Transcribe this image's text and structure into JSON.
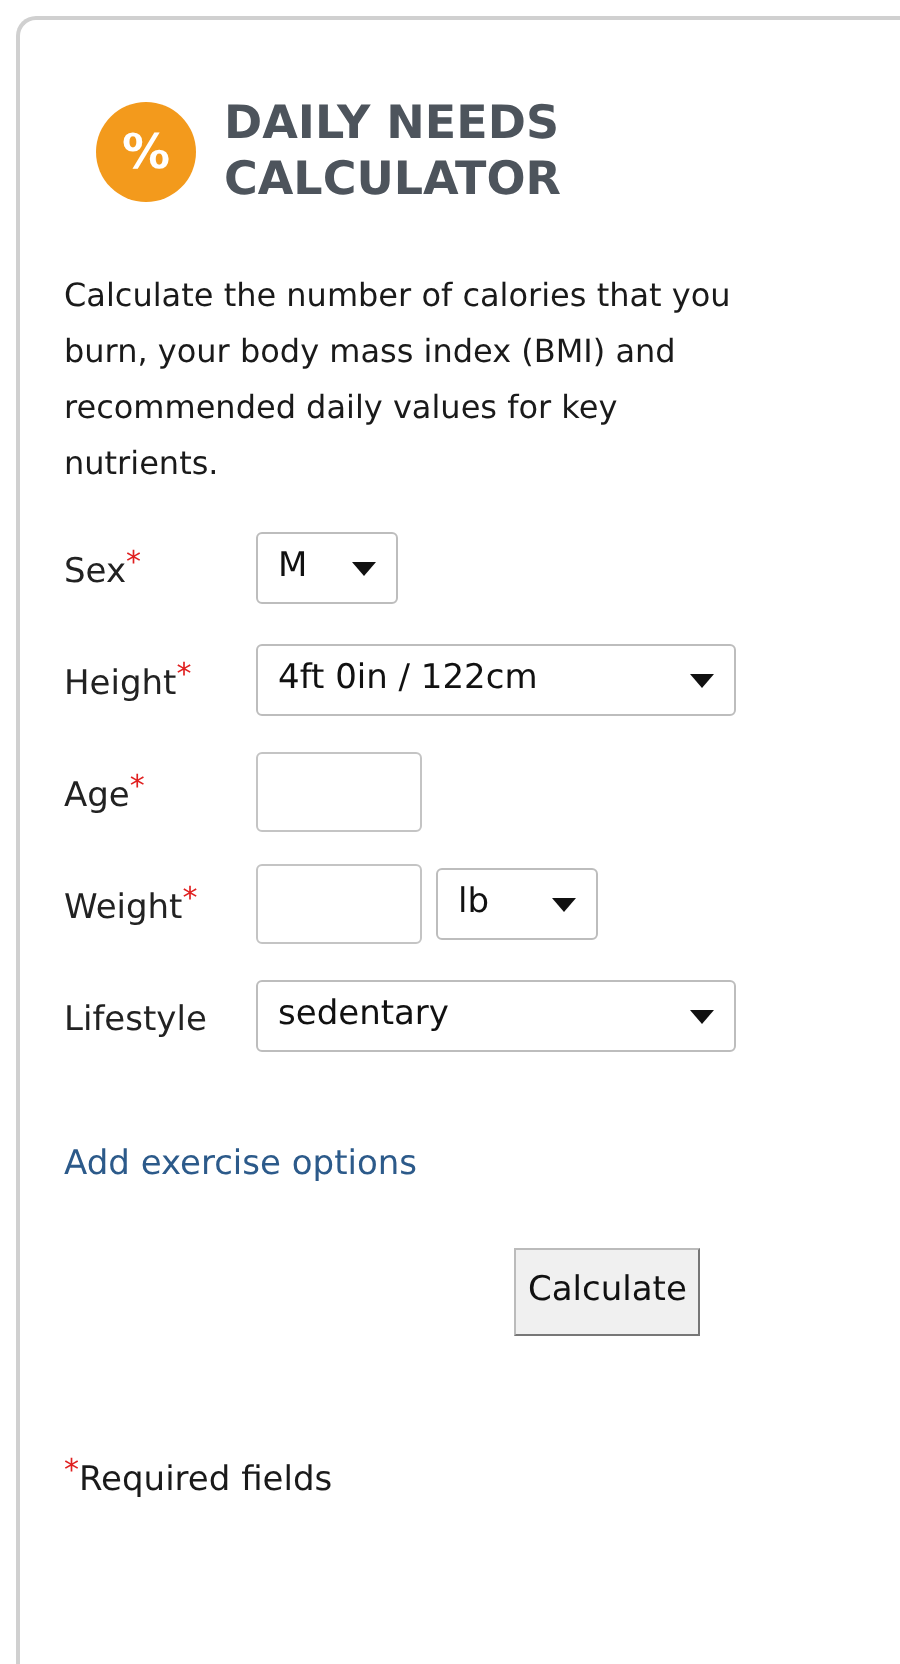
{
  "header": {
    "icon_glyph": "%",
    "title": "DAILY NEEDS CALCULATOR"
  },
  "intro": "Calculate the number of calories that you burn, your body mass index (BMI) and recommended daily values for key nutrients.",
  "fields": [
    {
      "kind": "short_select",
      "label": "Sex",
      "required_mark": "*",
      "value": "M"
    },
    {
      "kind": "select",
      "label": "Height",
      "required_mark": "*",
      "value": "4ft 0in / 122cm"
    },
    {
      "kind": "input",
      "label": "Age",
      "required_mark": "*"
    },
    {
      "kind": "input_unit",
      "label": "Weight",
      "required_mark": "*",
      "unit": "lb"
    },
    {
      "kind": "select",
      "label": "Lifestyle",
      "value": "sedentary"
    }
  ],
  "link": "Add exercise options",
  "button": "Calculate",
  "footnote": {
    "mark": "*",
    "text": "Required fields"
  }
}
